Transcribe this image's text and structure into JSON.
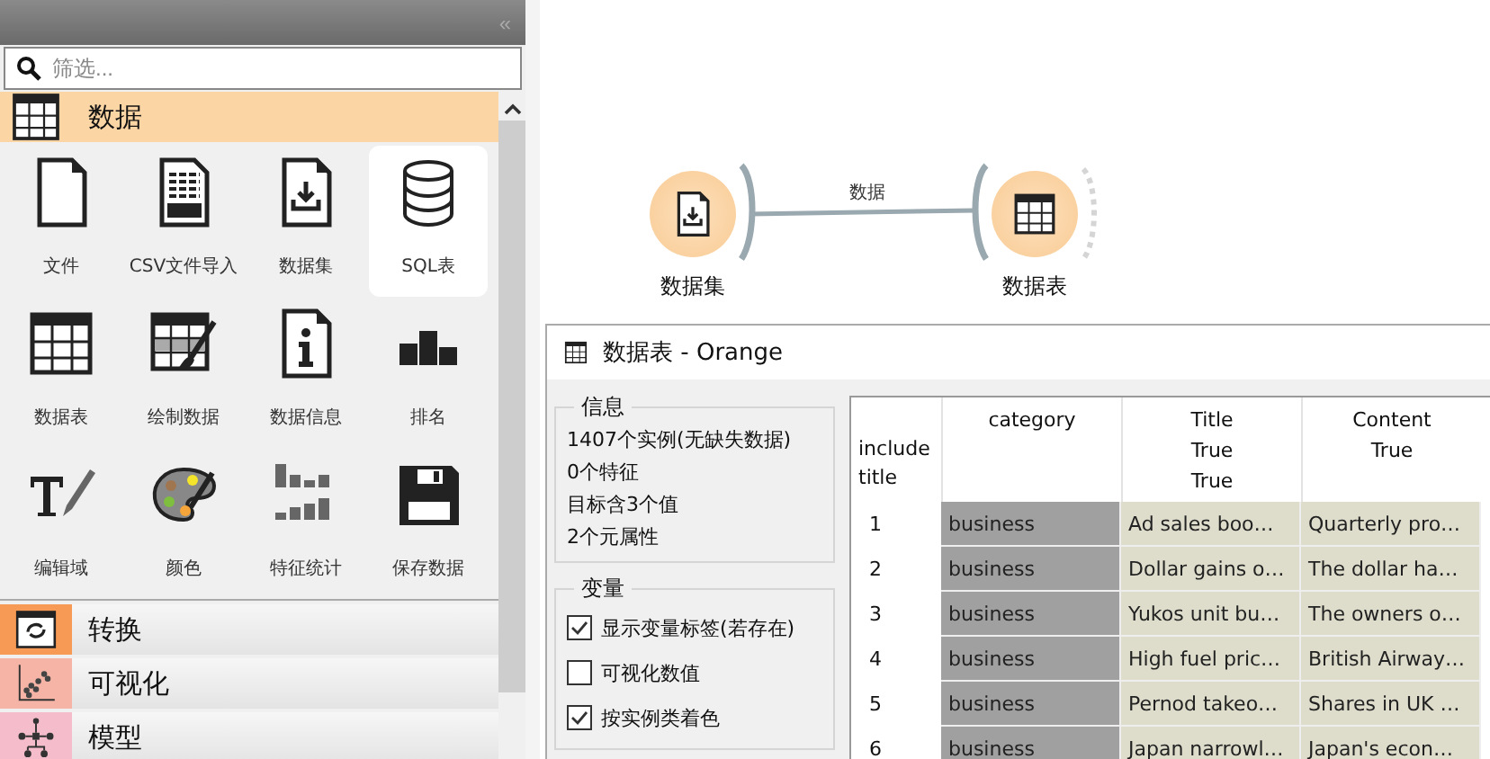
{
  "sidebar": {
    "collapse_glyph": "«",
    "search": {
      "placeholder": "筛选..."
    },
    "categories": [
      {
        "label": "数据",
        "expanded": true,
        "color": "#fcd5a5",
        "kind": "table",
        "widgets": [
          {
            "label": "文件",
            "kind": "file",
            "selected": false
          },
          {
            "label": "CSV文件导入",
            "kind": "csv",
            "selected": false
          },
          {
            "label": "数据集",
            "kind": "download",
            "selected": false
          },
          {
            "label": "SQL表",
            "kind": "database",
            "selected": true
          },
          {
            "label": "数据表",
            "kind": "table",
            "selected": false
          },
          {
            "label": "绘制数据",
            "kind": "paint",
            "selected": false
          },
          {
            "label": "数据信息",
            "kind": "info",
            "selected": false
          },
          {
            "label": "排名",
            "kind": "rank",
            "selected": false
          },
          {
            "label": "编辑域",
            "kind": "edit",
            "selected": false
          },
          {
            "label": "颜色",
            "kind": "palette",
            "selected": false
          },
          {
            "label": "特征统计",
            "kind": "bars",
            "selected": false
          },
          {
            "label": "保存数据",
            "kind": "floppy",
            "selected": false
          }
        ]
      },
      {
        "label": "转换",
        "expanded": false,
        "color": "#f79a55",
        "kind": "transform"
      },
      {
        "label": "可视化",
        "expanded": false,
        "color": "#f5b4a6",
        "kind": "scatter"
      },
      {
        "label": "模型",
        "expanded": false,
        "color": "#f5bccb",
        "kind": "tree"
      }
    ]
  },
  "canvas": {
    "nodes": [
      {
        "label": "数据集",
        "kind": "download"
      },
      {
        "label": "数据表",
        "kind": "table"
      }
    ],
    "links": [
      {
        "label": "数据"
      }
    ]
  },
  "data_window": {
    "title": "数据表 - Orange",
    "info": {
      "title": "信息",
      "lines": [
        "1407个实例(无缺失数据)",
        "0个特征",
        "目标含3个值",
        "2个元属性"
      ]
    },
    "variables": {
      "title": "变量",
      "options": [
        {
          "label": "显示变量标签(若存在)",
          "checked": true
        },
        {
          "label": "可视化数值",
          "checked": false
        },
        {
          "label": "按实例类着色",
          "checked": true
        }
      ]
    },
    "table": {
      "corner": [
        "include",
        "title"
      ],
      "columns": [
        {
          "lines": [
            "category"
          ]
        },
        {
          "lines": [
            "Title",
            "True",
            "True"
          ]
        },
        {
          "lines": [
            "Content",
            "True"
          ]
        }
      ],
      "rows": [
        {
          "index": "1",
          "cells": [
            "business",
            "Ad sales boo…",
            "Quarterly pro…"
          ]
        },
        {
          "index": "2",
          "cells": [
            "business",
            "Dollar gains o…",
            "The dollar ha…"
          ]
        },
        {
          "index": "3",
          "cells": [
            "business",
            "Yukos unit bu…",
            "The owners o…"
          ]
        },
        {
          "index": "4",
          "cells": [
            "business",
            "High fuel pric…",
            "British Airway…"
          ]
        },
        {
          "index": "5",
          "cells": [
            "business",
            "Pernod takeo…",
            "Shares in UK …"
          ]
        },
        {
          "index": "6",
          "cells": [
            "business",
            "Japan narrowl…",
            "Japan's econ…"
          ]
        }
      ]
    }
  }
}
